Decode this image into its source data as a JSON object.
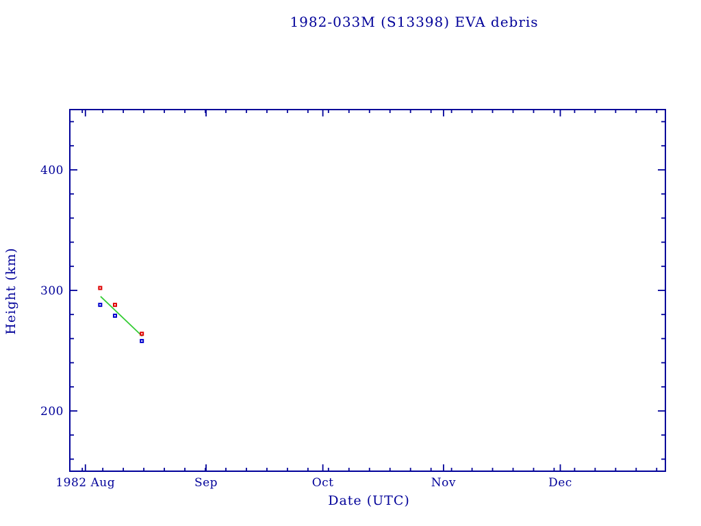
{
  "chart_data": {
    "type": "scatter",
    "title": "1982-033M (S13398) EVA debris",
    "xlabel": "Date (UTC)",
    "ylabel": "Height (km)",
    "axis_color": "#000099",
    "background": "#ffffff",
    "grid": false,
    "legend": false,
    "x_axis": {
      "start_date": "1982 Jul 28",
      "end_date": "1982 Dec 28",
      "start_day": 0,
      "end_day": 153,
      "month_ticks": [
        {
          "label": "1982 Aug",
          "day": 4
        },
        {
          "label": "Sep",
          "day": 35
        },
        {
          "label": "Oct",
          "day": 65
        },
        {
          "label": "Nov",
          "day": 96
        },
        {
          "label": "Dec",
          "day": 126
        }
      ],
      "minor_tick_start_day": 3.2,
      "minor_tick_interval_days": 5.27
    },
    "y_axis": {
      "min": 150,
      "max": 450,
      "major_ticks": [
        200,
        300,
        400
      ],
      "minor_tick_interval": 20
    },
    "series": [
      {
        "name": "upper height (red open squares)",
        "slug": "red-square-series",
        "type": "scatter",
        "marker": "open-square",
        "color": "#dd0000",
        "points": [
          {
            "date": "1982 Aug 5",
            "day": 7.8,
            "height_km": 302
          },
          {
            "date": "1982 Aug 9",
            "day": 11.6,
            "height_km": 288
          },
          {
            "date": "1982 Aug 16",
            "day": 18.5,
            "height_km": 264
          }
        ]
      },
      {
        "name": "lower height (blue open squares)",
        "slug": "blue-square-series",
        "type": "scatter",
        "marker": "open-square",
        "color": "#0000cc",
        "points": [
          {
            "date": "1982 Aug 5",
            "day": 7.8,
            "height_km": 288
          },
          {
            "date": "1982 Aug 9",
            "day": 11.6,
            "height_km": 279
          },
          {
            "date": "1982 Aug 16",
            "day": 18.5,
            "height_km": 258
          }
        ]
      },
      {
        "name": "decay trend (green line)",
        "slug": "green-trend-line",
        "type": "line",
        "color": "#33cc33",
        "points": [
          {
            "date": "1982 Aug 5",
            "day": 7.9,
            "height_km": 295
          },
          {
            "date": "1982 Aug 16",
            "day": 18.6,
            "height_km": 262
          }
        ]
      }
    ]
  }
}
